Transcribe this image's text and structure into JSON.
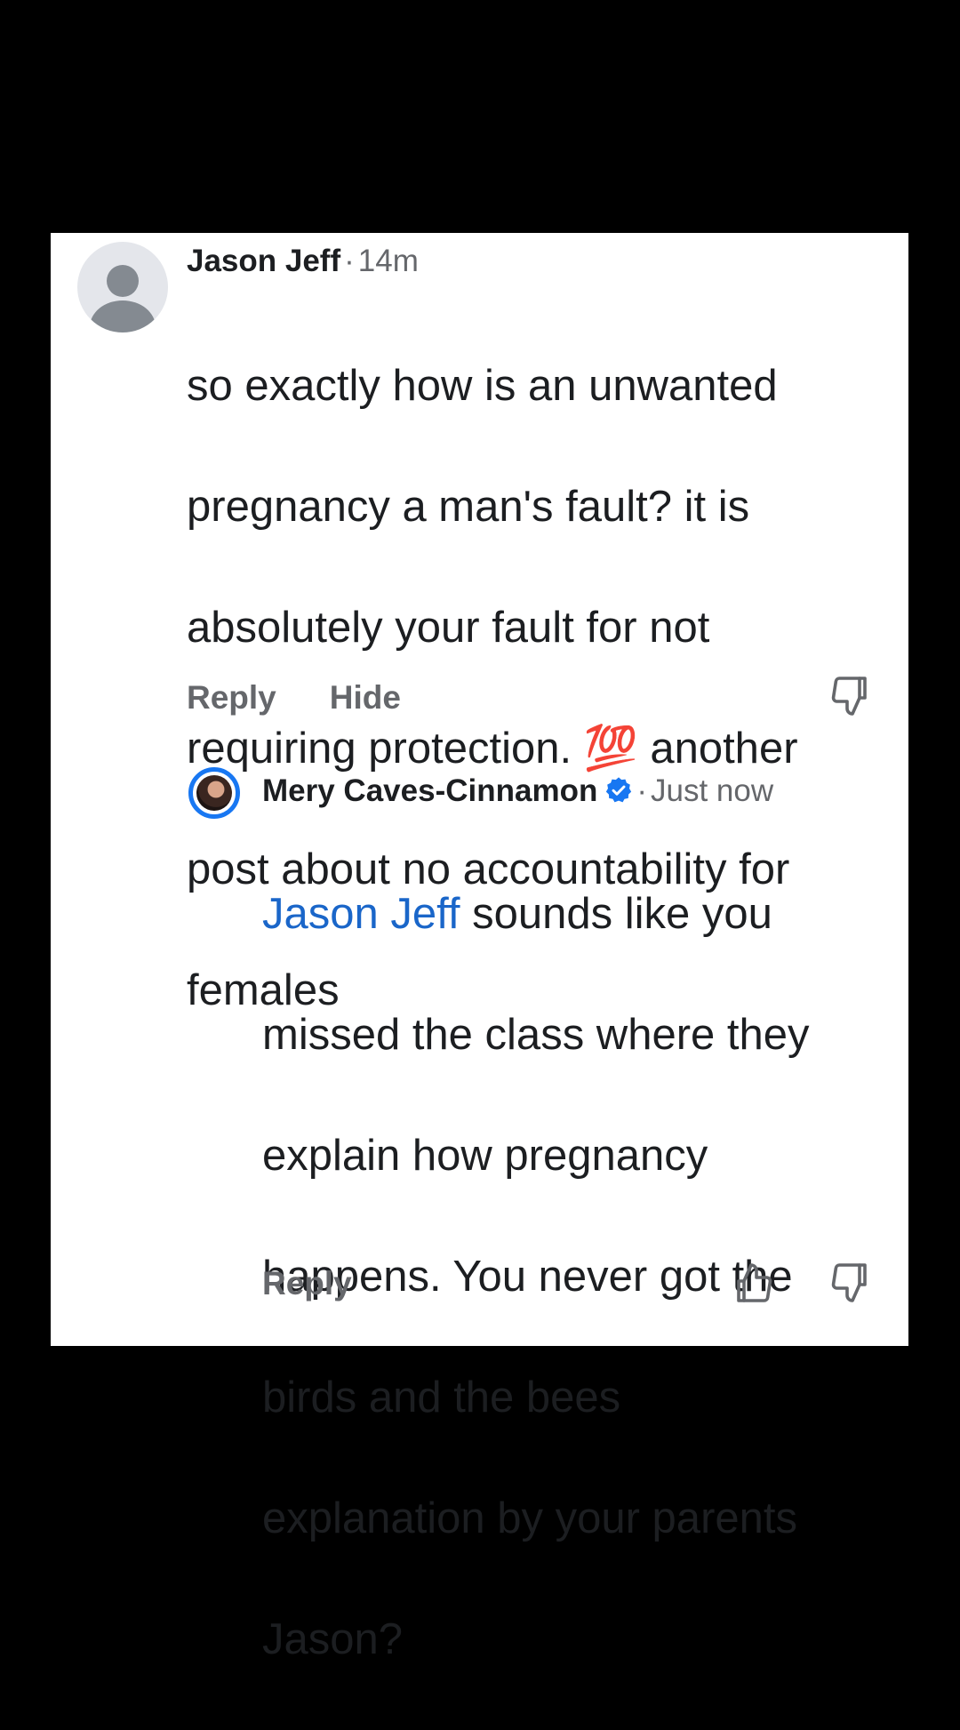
{
  "parent_comment": {
    "author": "Jason Jeff",
    "separator": "·",
    "time": "14m",
    "body_lines": [
      "so exactly how is an unwanted",
      "pregnancy a man's fault? it is",
      "absolutely your fault for not",
      "requiring protection. 💯 another",
      "post about no accountability for",
      "females"
    ],
    "reply_label": "Reply",
    "hide_label": "Hide",
    "dislike_icon": "thumbs-down-icon"
  },
  "reply_comment": {
    "author": "Mery Caves-Cinnamon",
    "verified_icon": "verified-badge-icon",
    "separator": "·",
    "time": "Just now",
    "mention": "Jason Jeff",
    "body_first_line_rest": " sounds like you",
    "body_lines": [
      "missed the class where they",
      "explain how pregnancy",
      "happens. You never got the",
      "birds and the bees",
      "explanation by your parents",
      "Jason?"
    ],
    "reply_label": "Reply",
    "like_icon": "thumbs-up-icon",
    "dislike_icon": "thumbs-down-icon"
  },
  "colors": {
    "background": "#000000",
    "card": "#ffffff",
    "text_primary": "#1c1e21",
    "text_secondary": "#65676b",
    "accent_blue": "#1877f2",
    "mention_blue": "#1a66c9"
  }
}
